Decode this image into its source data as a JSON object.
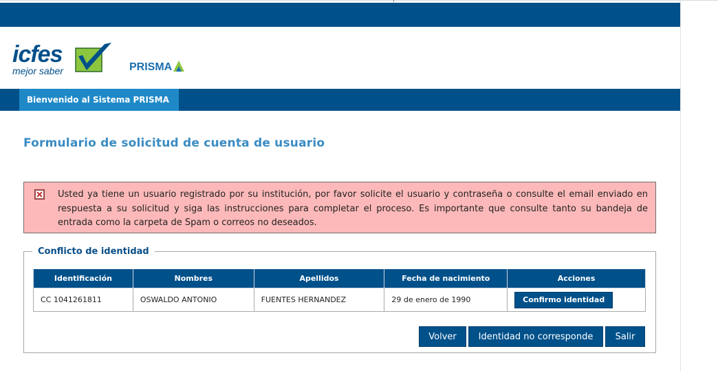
{
  "header": {
    "logo_icfes_text": "icfes",
    "logo_icfes_tagline": "mejor saber",
    "logo_prisma_text": "PRISMA"
  },
  "nav": {
    "tab_label": "Bienvenido al Sistema PRISMA"
  },
  "page": {
    "title": "Formulario de solicitud de cuenta de usuario"
  },
  "alert": {
    "message": "Usted ya tiene un usuario registrado por su institución, por favor solicite el usuario y contraseña o consulte el email enviado en respuesta a su solicitud y siga las instrucciones para completar el proceso. Es importante que consulte tanto su bandeja de entrada como la carpeta de Spam o correos no deseados."
  },
  "conflict": {
    "legend": "Conflicto de identidad",
    "columns": [
      "Identificación",
      "Nombres",
      "Apellidos",
      "Fecha de nacimiento",
      "Acciones"
    ],
    "rows": [
      {
        "identificacion": "CC 1041261811",
        "nombres": "OSWALDO ANTONIO",
        "apellidos": "FUENTES HERNANDEZ",
        "fecha": "29 de enero de 1990",
        "accion_label": "Confirmo identidad"
      }
    ]
  },
  "buttons": {
    "volver": "Volver",
    "no_corresponde": "Identidad no corresponde",
    "salir": "Salir"
  },
  "colors": {
    "primary": "#00508a",
    "accent": "#1f89c8",
    "title": "#3a8cc3",
    "alert_bg": "#fdb9b9",
    "logo_green": "#8cc63f"
  }
}
